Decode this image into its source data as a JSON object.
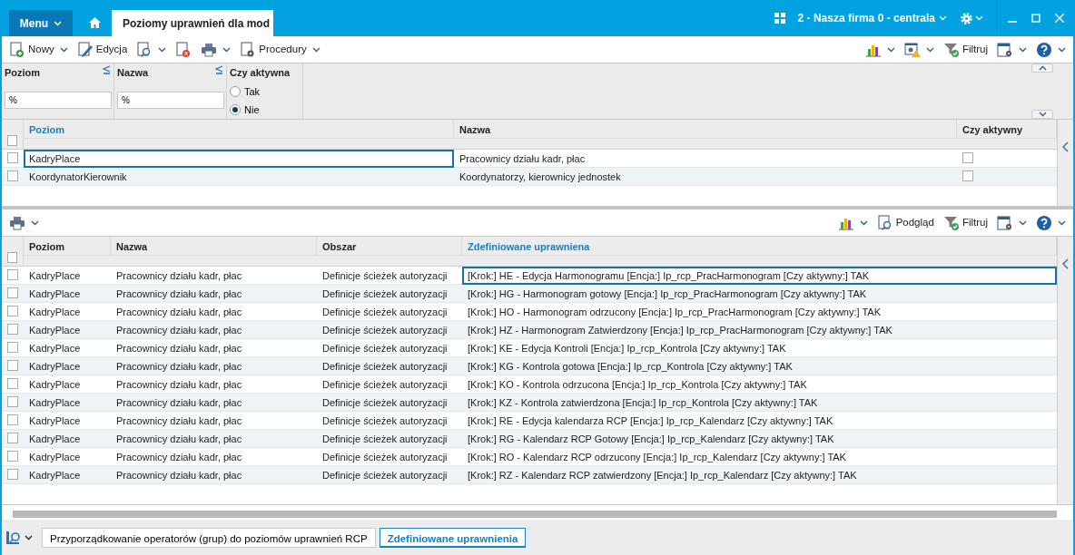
{
  "app_bar": {
    "menu_label": "Menu",
    "tab_title": "Poziomy uprawnień dla mod",
    "company": "2 - Nasza firma 0 - centrala"
  },
  "toolbar": {
    "left": [
      {
        "kind": "new",
        "label": "Nowy",
        "dropdown": true
      },
      {
        "kind": "edit",
        "label": "Edycja",
        "dropdown": false
      },
      {
        "kind": "preview",
        "dropdown": true
      },
      {
        "kind": "delete",
        "dropdown": false
      },
      {
        "kind": "print",
        "dropdown": true
      },
      {
        "kind": "procedure",
        "label": "Procedury",
        "dropdown": true
      }
    ],
    "right": [
      {
        "kind": "chart",
        "dropdown": true
      },
      {
        "kind": "warning",
        "dropdown": true
      },
      {
        "kind": "filter",
        "label": "Filtruj",
        "dropdown": false
      },
      {
        "kind": "columns",
        "dropdown": true
      },
      {
        "kind": "help",
        "dropdown": true
      }
    ]
  },
  "filters": {
    "fields": [
      {
        "label": "Poziom",
        "value": "%"
      },
      {
        "label": "Nazwa",
        "value": "%"
      }
    ],
    "active": {
      "label": "Czy aktywna",
      "options": [
        {
          "label": "Tak",
          "selected": false
        },
        {
          "label": "Nie",
          "selected": true
        }
      ]
    }
  },
  "upper_table": {
    "all_checked": false,
    "columns": [
      {
        "label": "Poziom",
        "sorted": true
      },
      {
        "label": "Nazwa",
        "sorted": false
      },
      {
        "label": "Czy aktywny",
        "sorted": false
      }
    ],
    "rows": [
      {
        "cells": [
          "KadryPlace",
          "Pracownicy działu kadr, płac"
        ],
        "checked": false,
        "active": false,
        "selected": true
      },
      {
        "cells": [
          "KoordynatorKierownik",
          "Koordynatorzy, kierownicy jednostek"
        ],
        "checked": false,
        "active": false,
        "selected": false
      }
    ]
  },
  "lower_toolbar": {
    "left": [
      {
        "kind": "print",
        "dropdown": true
      }
    ],
    "right": [
      {
        "kind": "chart",
        "dropdown": true
      },
      {
        "kind": "preview",
        "label": "Podgląd",
        "dropdown": false
      },
      {
        "kind": "filter",
        "label": "Filtruj",
        "dropdown": false
      },
      {
        "kind": "columns",
        "dropdown": true
      },
      {
        "kind": "help",
        "dropdown": true
      }
    ]
  },
  "lower_table": {
    "all_checked": false,
    "columns": [
      {
        "label": "Poziom",
        "sorted": false
      },
      {
        "label": "Nazwa",
        "sorted": false
      },
      {
        "label": "Obszar",
        "sorted": false
      },
      {
        "label": "Zdefiniowane uprawniena",
        "sorted": true
      }
    ],
    "rows": [
      {
        "cells": [
          "KadryPlace",
          "Pracownicy działu kadr, płac",
          "Definicje ścieżek autoryzacji",
          "[Krok:] HE - Edycja Harmonogramu [Encja:] Ip_rcp_PracHarmonogram [Czy aktywny:] TAK"
        ],
        "checked": false,
        "selected": true
      },
      {
        "cells": [
          "KadryPlace",
          "Pracownicy działu kadr, płac",
          "Definicje ścieżek autoryzacji",
          "[Krok:] HG - Harmonogram gotowy [Encja:] Ip_rcp_PracHarmonogram [Czy aktywny:] TAK"
        ],
        "checked": false,
        "selected": false
      },
      {
        "cells": [
          "KadryPlace",
          "Pracownicy działu kadr, płac",
          "Definicje ścieżek autoryzacji",
          "[Krok:] HO - Harmonogram odrzucony [Encja:] Ip_rcp_PracHarmonogram [Czy aktywny:] TAK"
        ],
        "checked": false,
        "selected": false
      },
      {
        "cells": [
          "KadryPlace",
          "Pracownicy działu kadr, płac",
          "Definicje ścieżek autoryzacji",
          "[Krok:] HZ - Harmonogram Zatwierdzony [Encja:] Ip_rcp_PracHarmonogram [Czy aktywny:] TAK"
        ],
        "checked": false,
        "selected": false
      },
      {
        "cells": [
          "KadryPlace",
          "Pracownicy działu kadr, płac",
          "Definicje ścieżek autoryzacji",
          "[Krok:] KE - Edycja Kontroli [Encja:] Ip_rcp_Kontrola [Czy aktywny:] TAK"
        ],
        "checked": false,
        "selected": false
      },
      {
        "cells": [
          "KadryPlace",
          "Pracownicy działu kadr, płac",
          "Definicje ścieżek autoryzacji",
          "[Krok:] KG - Kontrola gotowa [Encja:] Ip_rcp_Kontrola [Czy aktywny:] TAK"
        ],
        "checked": false,
        "selected": false
      },
      {
        "cells": [
          "KadryPlace",
          "Pracownicy działu kadr, płac",
          "Definicje ścieżek autoryzacji",
          "[Krok:] KO - Kontrola odrzucona [Encja:] Ip_rcp_Kontrola [Czy aktywny:] TAK"
        ],
        "checked": false,
        "selected": false
      },
      {
        "cells": [
          "KadryPlace",
          "Pracownicy działu kadr, płac",
          "Definicje ścieżek autoryzacji",
          "[Krok:] KZ - Kontrola zatwierdzona [Encja:] Ip_rcp_Kontrola [Czy aktywny:] TAK"
        ],
        "checked": false,
        "selected": false
      },
      {
        "cells": [
          "KadryPlace",
          "Pracownicy działu kadr, płac",
          "Definicje ścieżek autoryzacji",
          "[Krok:] RE - Edycja kalendarza RCP [Encja:] Ip_rcp_Kalendarz [Czy aktywny:] TAK"
        ],
        "checked": false,
        "selected": false
      },
      {
        "cells": [
          "KadryPlace",
          "Pracownicy działu kadr, płac",
          "Definicje ścieżek autoryzacji",
          "[Krok:] RG - Kalendarz RCP Gotowy [Encja:] Ip_rcp_Kalendarz [Czy aktywny:] TAK"
        ],
        "checked": false,
        "selected": false
      },
      {
        "cells": [
          "KadryPlace",
          "Pracownicy działu kadr, płac",
          "Definicje ścieżek autoryzacji",
          "[Krok:] RO - Kalendarz RCP odrzucony [Encja:] Ip_rcp_Kalendarz [Czy aktywny:] TAK"
        ],
        "checked": false,
        "selected": false
      },
      {
        "cells": [
          "KadryPlace",
          "Pracownicy działu kadr, płac",
          "Definicje ścieżek autoryzacji",
          "[Krok:] RZ - Kalendarz RCP zatwierdzony [Encja:] Ip_rcp_Kalendarz [Czy aktywny:] TAK"
        ],
        "checked": false,
        "selected": false
      }
    ]
  },
  "bottom_tabs": [
    {
      "label": "Przyporządkowanie operatorów (grup) do poziomów uprawnień RCP",
      "selected": false
    },
    {
      "label": "Zdefiniowane uprawnienia",
      "selected": true
    }
  ]
}
